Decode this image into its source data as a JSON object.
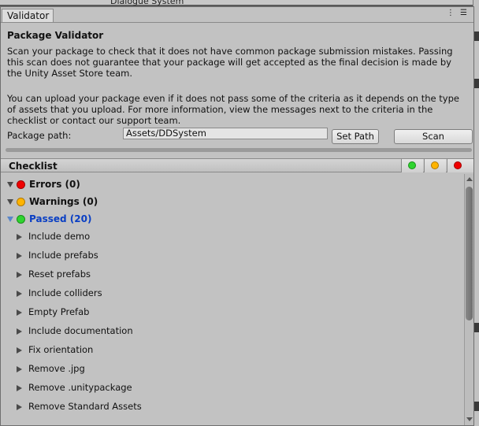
{
  "background": {
    "top_fragment": "Dialogue System"
  },
  "window": {
    "tab_label": "Validator",
    "window_icons": "⋮ ☰"
  },
  "header": {
    "title": "Package Validator",
    "description_1": "Scan your package to check that it does not have common package submission mistakes. Passing this scan does not guarantee that your package will get accepted as the final decision is made by the Unity Asset Store team.",
    "description_2": "You can upload your package even if it does not pass some of the criteria as it depends on the type of assets that you upload. For more information, view the messages next to the criteria in the checklist or contact our support team."
  },
  "path": {
    "label": "Package path:",
    "value": "Assets/DDSystem",
    "set_path_label": "Set Path",
    "scan_label": "Scan"
  },
  "checklist": {
    "title": "Checklist",
    "colors": {
      "passed": "#2fd42f",
      "warning": "#ffb400",
      "error": "#f00000",
      "passed_text": "#0a3fc4"
    },
    "categories": [
      {
        "label": "Errors (0)",
        "status": "error"
      },
      {
        "label": "Warnings (0)",
        "status": "warning"
      },
      {
        "label": "Passed (20)",
        "status": "passed"
      }
    ],
    "items": [
      "Include demo",
      "Include prefabs",
      "Reset prefabs",
      "Include colliders",
      "Empty Prefab",
      "Include documentation",
      "Fix orientation",
      "Remove .jpg",
      "Remove .unitypackage",
      "Remove Standard Assets"
    ]
  }
}
